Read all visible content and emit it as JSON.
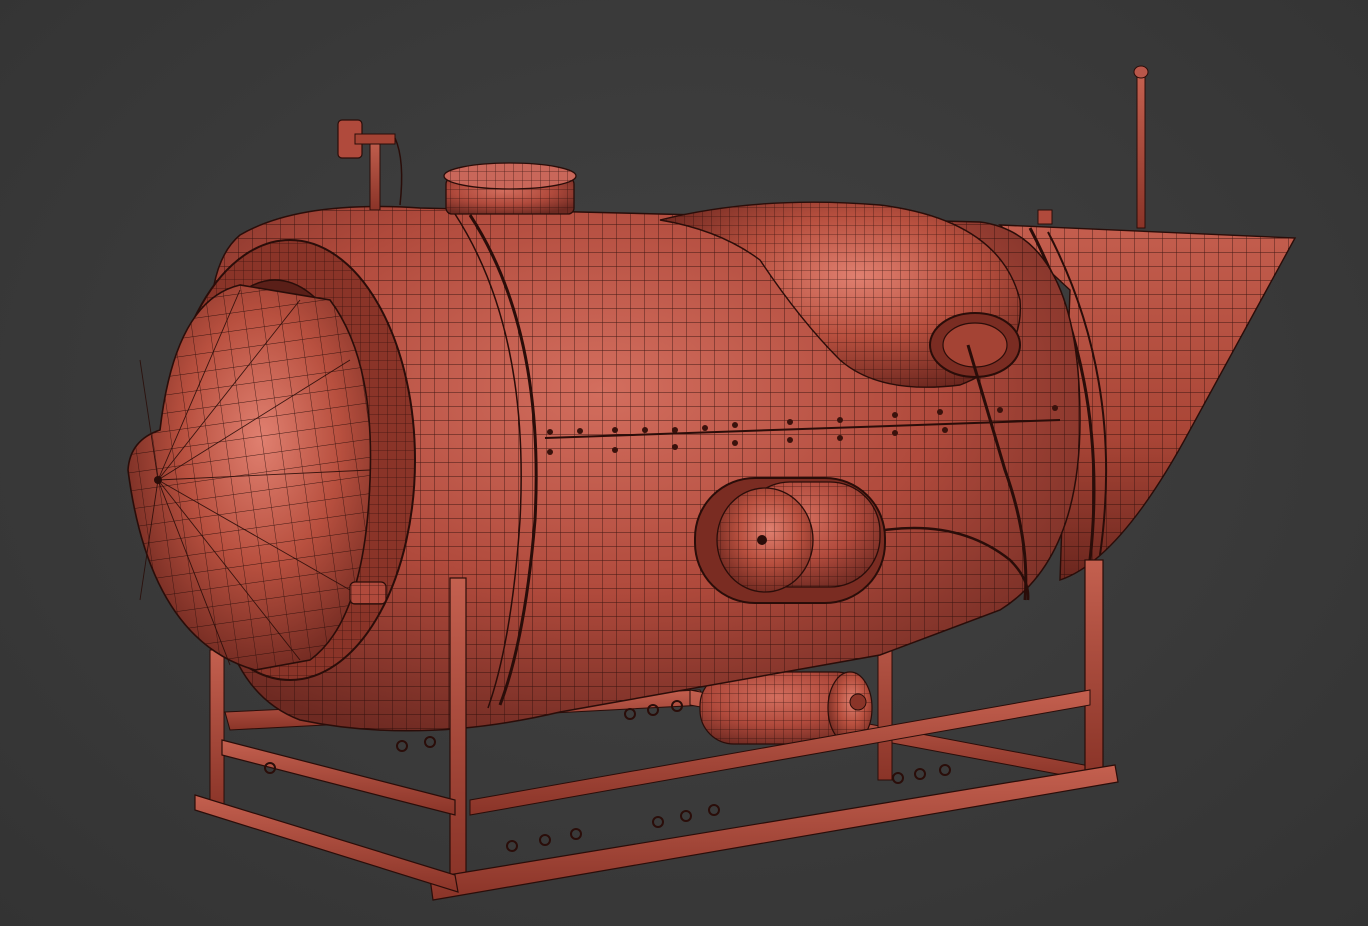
{
  "scene": {
    "subject": "submersible-wireframe-render",
    "colors": {
      "background": "#3a3a3a",
      "body": "#b04a3c",
      "body_light": "#cf6a5a",
      "body_dark": "#6e2a22",
      "wire": "#2a0d09",
      "frame": "#b9574a"
    }
  }
}
